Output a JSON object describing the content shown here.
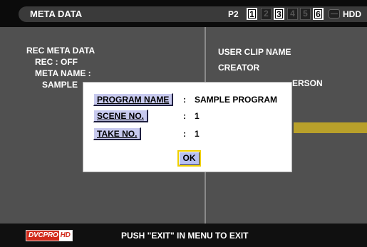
{
  "header": {
    "title": "META DATA",
    "p2_label": "P2",
    "slots": [
      "1",
      "2",
      "3",
      "4",
      "5",
      "6"
    ],
    "hdd_label": "HDD"
  },
  "left_panel": {
    "heading": "REC META DATA",
    "rec": "REC : OFF",
    "meta_name": "META NAME :",
    "sample": "SAMPLE"
  },
  "right_panel": {
    "items": [
      "USER CLIP NAME",
      "CREATOR"
    ],
    "partial": "ERSON"
  },
  "dialog": {
    "rows": [
      {
        "label": "PROGRAM NAME",
        "colon": ":",
        "value": "SAMPLE PROGRAM"
      },
      {
        "label": "SCENE NO.",
        "colon": ":",
        "value": "1"
      },
      {
        "label": "TAKE NO.",
        "colon": ":",
        "value": "1"
      }
    ],
    "ok_label": "OK"
  },
  "footer": {
    "logo_text": "DVCPRO",
    "logo_hd": "HD",
    "message": "PUSH \"EXIT\" IN MENU TO EXIT"
  },
  "colors": {
    "panel": "#505050",
    "label_bg": "#c7c9ee",
    "ok_border": "#f0d000",
    "highlight": "#b8a02a",
    "logo": "#d12a1a"
  }
}
